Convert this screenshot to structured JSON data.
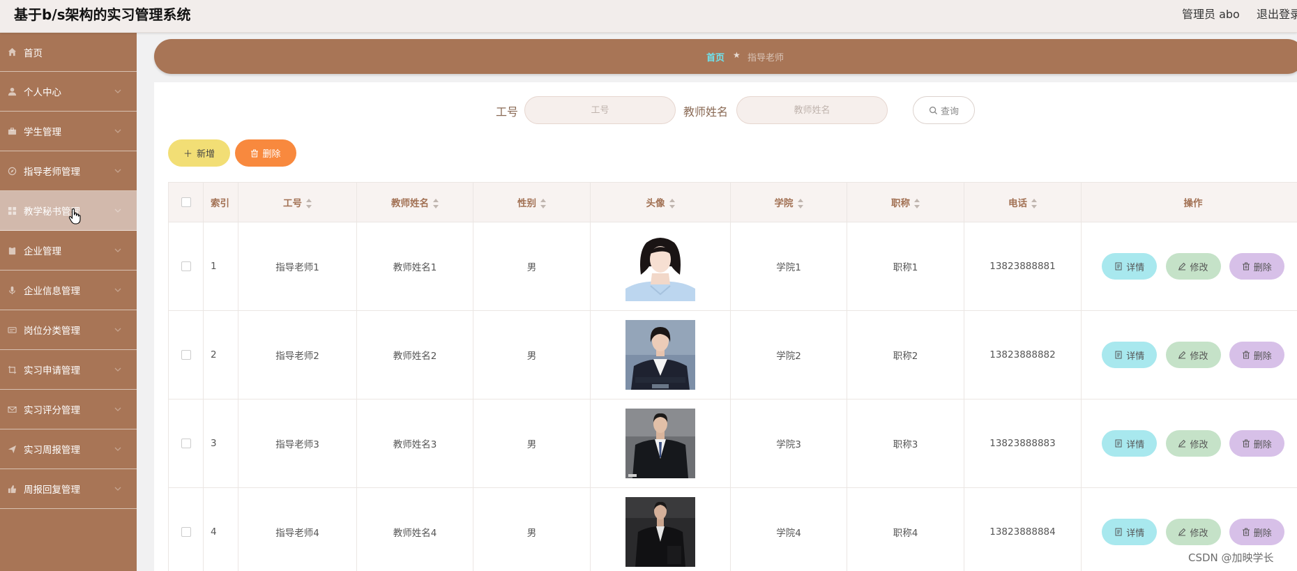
{
  "header": {
    "title": "基于b/s架构的实习管理系统",
    "admin": "管理员 abo",
    "logout": "退出登录"
  },
  "sidebar": {
    "items": [
      {
        "label": "首页",
        "icon": "home-icon"
      },
      {
        "label": "个人中心",
        "icon": "user-icon"
      },
      {
        "label": "学生管理",
        "icon": "briefcase-icon"
      },
      {
        "label": "指导老师管理",
        "icon": "compass-icon"
      },
      {
        "label": "教学秘书管理",
        "icon": "grid-icon"
      },
      {
        "label": "企业管理",
        "icon": "clipboard-icon"
      },
      {
        "label": "企业信息管理",
        "icon": "microphone-icon"
      },
      {
        "label": "岗位分类管理",
        "icon": "card-icon"
      },
      {
        "label": "实习申请管理",
        "icon": "crop-icon"
      },
      {
        "label": "实习评分管理",
        "icon": "mail-icon"
      },
      {
        "label": "实习周报管理",
        "icon": "send-icon"
      },
      {
        "label": "周报回复管理",
        "icon": "thumbs-up-icon"
      }
    ]
  },
  "breadcrumb": {
    "home": "首页",
    "separator": "★",
    "current": "指导老师"
  },
  "search": {
    "label_no": "工号",
    "placeholder_no": "工号",
    "label_name": "教师姓名",
    "placeholder_name": "教师姓名",
    "query": "查询"
  },
  "actions": {
    "add": "新增",
    "delete": "删除"
  },
  "table": {
    "columns": [
      "索引",
      "工号",
      "教师姓名",
      "性别",
      "头像",
      "学院",
      "职称",
      "电话",
      "操作"
    ],
    "rows": [
      {
        "index": "1",
        "no": "指导老师1",
        "name": "教师姓名1",
        "gender": "男",
        "college": "学院1",
        "title": "职称1",
        "phone": "13823888881"
      },
      {
        "index": "2",
        "no": "指导老师2",
        "name": "教师姓名2",
        "gender": "男",
        "college": "学院2",
        "title": "职称2",
        "phone": "13823888882"
      },
      {
        "index": "3",
        "no": "指导老师3",
        "name": "教师姓名3",
        "gender": "男",
        "college": "学院3",
        "title": "职称3",
        "phone": "13823888883"
      },
      {
        "index": "4",
        "no": "指导老师4",
        "name": "教师姓名4",
        "gender": "男",
        "college": "学院4",
        "title": "职称4",
        "phone": "13823888884"
      }
    ],
    "ops": {
      "detail": "详情",
      "edit": "修改",
      "delete": "删除"
    }
  },
  "watermark": "CSDN @加映学长",
  "colors": {
    "theme": "#a87556",
    "header_bg": "#f2edeb",
    "crumb_home": "#6ee3ee",
    "add_btn": "#f2de75",
    "delete_btn": "#f8893e",
    "detail_btn": "#a8e8ee",
    "edit_btn": "#c5e2c8",
    "delete_row_btn": "#d7c0e8"
  }
}
